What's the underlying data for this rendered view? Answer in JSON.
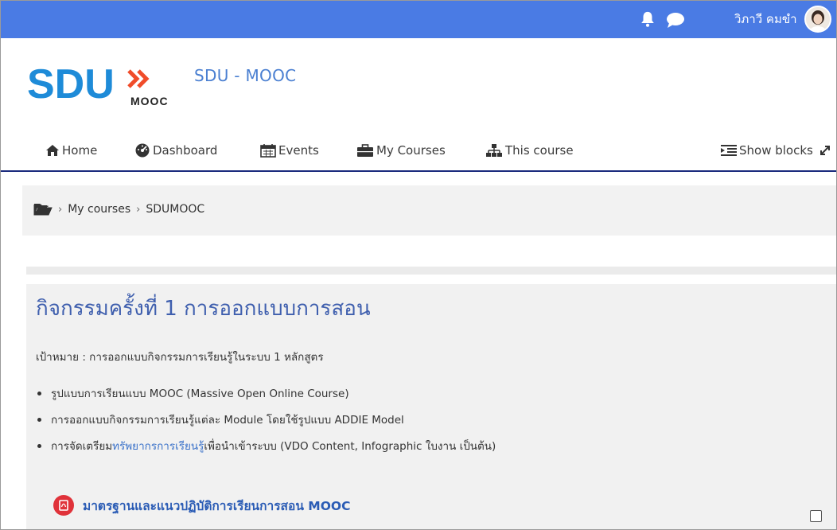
{
  "topbar": {
    "user_name": "วิภาวี คมขำ",
    "bg_color": "#4a7be4",
    "icons": [
      "bell-icon",
      "chat-icon"
    ]
  },
  "header": {
    "logo_text": "SDU",
    "logo_sub": "MOOC",
    "site_title": "SDU - MOOC"
  },
  "nav": {
    "items": [
      {
        "label": "Home",
        "icon": "home-icon"
      },
      {
        "label": "Dashboard",
        "icon": "dashboard-icon"
      },
      {
        "label": "Events",
        "icon": "calendar-icon"
      },
      {
        "label": "My Courses",
        "icon": "briefcase-icon"
      },
      {
        "label": "This course",
        "icon": "sitemap-icon"
      }
    ],
    "show_blocks": "Show blocks",
    "rule_color": "#1a2a7d"
  },
  "breadcrumb": {
    "icon": "folder-open-icon",
    "items": [
      "My courses",
      "SDUMOOC"
    ]
  },
  "section": {
    "title": "กิจกรรมครั้งที่ 1 การออกแบบการสอน",
    "goal": "เป้าหมาย : การออกแบบกิจกรรมการเรียนรู้ในระบบ 1 หลักสูตร",
    "bullets": [
      {
        "text": "รูปแบบการเรียนแบบ MOOC (Massive Open Online Course)"
      },
      {
        "text": "การออกแบบกิจกรรมการเรียนรู้แต่ละ Module โดยใช้รูปแบบ ADDIE Model"
      },
      {
        "pre": "การจัดเตรียม",
        "link": "ทรัพยากรการเรียนรู้",
        "post": "เพื่อนำเข้าระบบ (VDO Content, Infographic ใบงาน เป็นต้น)"
      }
    ],
    "activity": {
      "icon": "pdf-icon",
      "label": "มาตรฐานและแนวปฏิบัติการเรียนการสอน MOOC",
      "completion": false
    }
  }
}
